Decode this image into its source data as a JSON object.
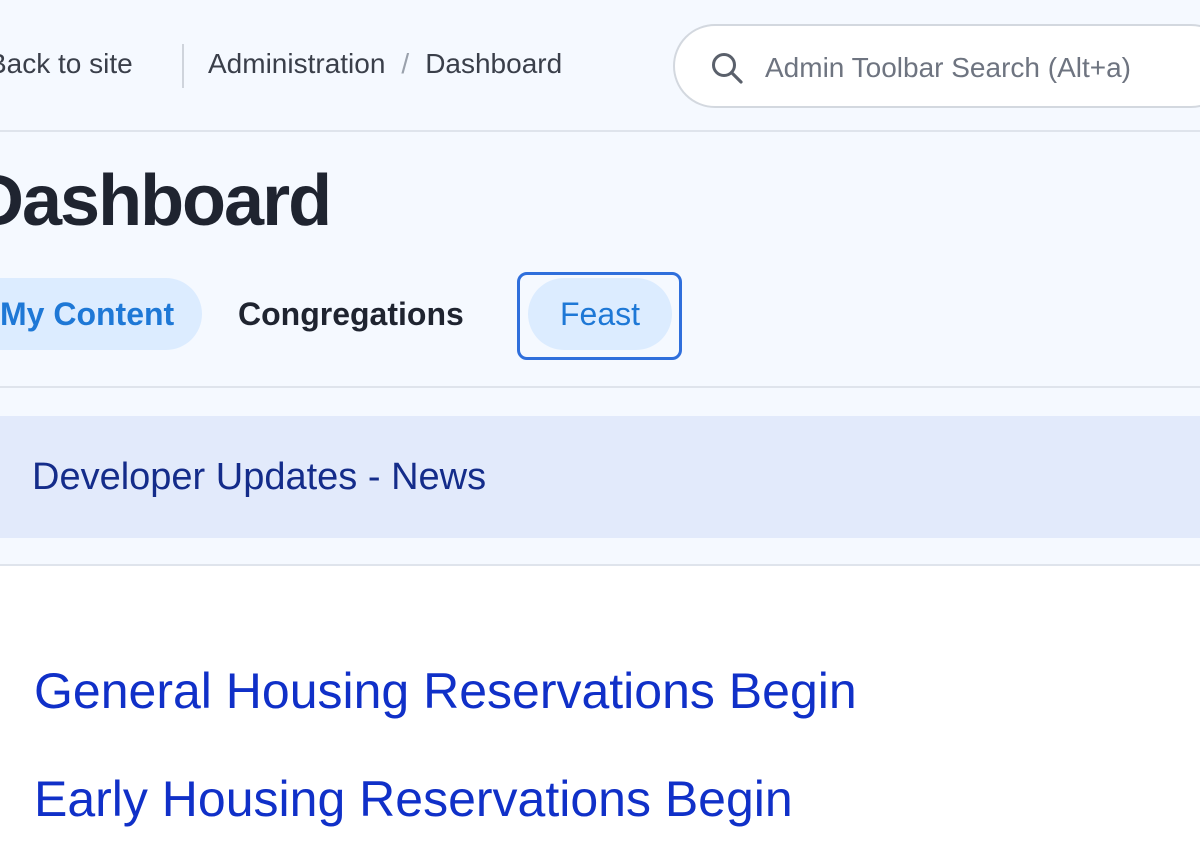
{
  "toolbar": {
    "back_label": "Back to site",
    "breadcrumb": [
      "Administration",
      "Dashboard"
    ],
    "breadcrumb_separator": "/",
    "search_placeholder": "Admin Toolbar Search (Alt+a)"
  },
  "page": {
    "title": "Dashboard"
  },
  "tabs": [
    {
      "label": "My Content",
      "active": true
    },
    {
      "label": "Congregations",
      "active": false
    },
    {
      "label": "Feast",
      "active": false,
      "focused": true
    }
  ],
  "panel": {
    "title": "Developer Updates - News",
    "links": [
      "General Housing Reservations Begin",
      "Early Housing Reservations Begin"
    ]
  },
  "colors": {
    "accent": "#1e78d6",
    "focus_ring": "#2f6fdc",
    "link": "#1030c8",
    "panel_header_bg": "#e2eafb"
  }
}
